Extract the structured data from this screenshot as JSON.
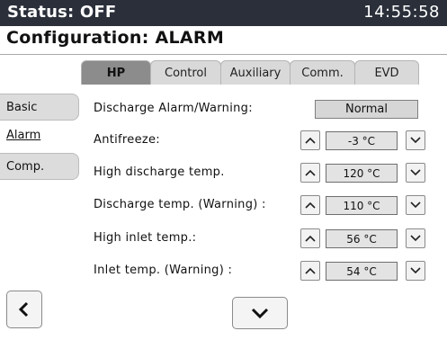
{
  "status_bar": {
    "status": "Status: OFF",
    "time": "14:55:58"
  },
  "title": "Configuration: ALARM",
  "tabs": [
    {
      "label": "HP",
      "active": true
    },
    {
      "label": "Control",
      "active": false
    },
    {
      "label": "Auxiliary",
      "active": false
    },
    {
      "label": "Comm.",
      "active": false
    },
    {
      "label": "EVD",
      "active": false
    }
  ],
  "sidebar": [
    {
      "label": "Basic",
      "active": false
    },
    {
      "label": "Alarm",
      "active": true
    },
    {
      "label": "Comp.",
      "active": false
    }
  ],
  "alarm": {
    "label": "Discharge Alarm/Warning:",
    "value": "Normal"
  },
  "params": [
    {
      "label": "Antifreeze:",
      "value": "-3 °C"
    },
    {
      "label": "High discharge temp.",
      "value": "120 °C"
    },
    {
      "label": "Discharge temp. (Warning) :",
      "value": "110 °C"
    },
    {
      "label": "High inlet temp.:",
      "value": "56 °C"
    },
    {
      "label": "Inlet temp. (Warning) :",
      "value": "54 °C"
    }
  ],
  "icons": {
    "up": "chevron-up-icon",
    "down": "chevron-down-icon",
    "back": "chevron-left-icon",
    "scroll": "chevron-down-icon"
  },
  "colors": {
    "status_bar_bg": "#2a2f3a",
    "active_tab": "#8c8c8c",
    "field_bg": "#e3e3e3"
  }
}
